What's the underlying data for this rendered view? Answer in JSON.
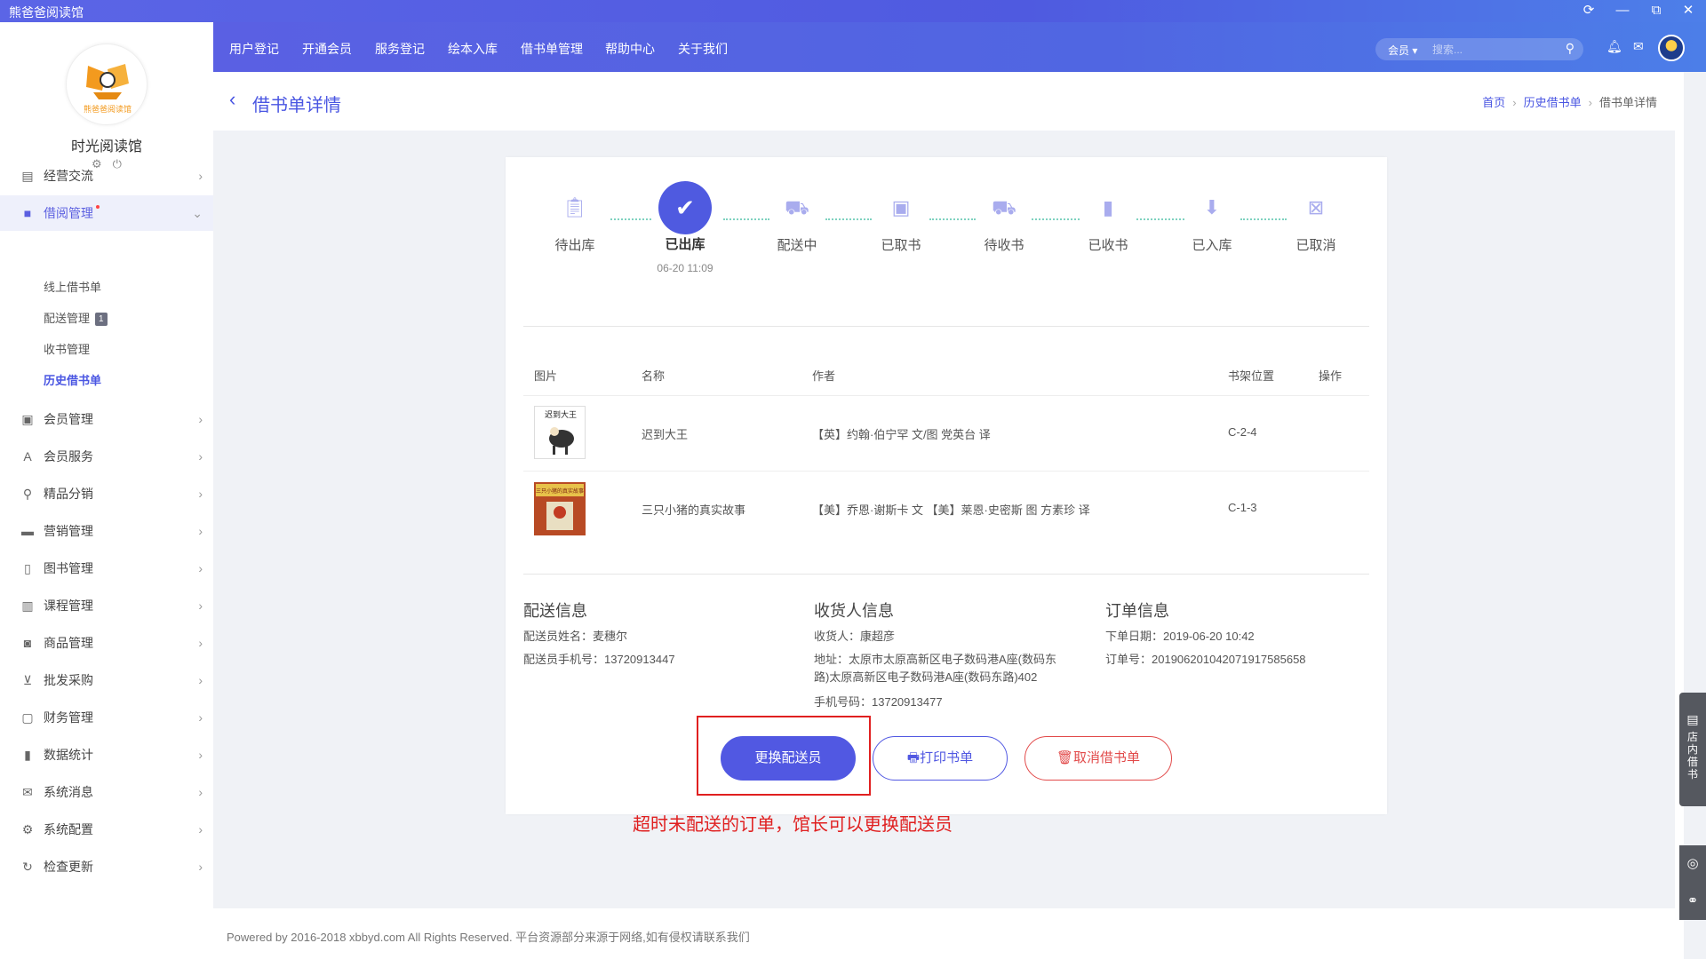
{
  "window": {
    "title": "熊爸爸阅读馆",
    "controls": [
      "refresh-icon",
      "minimize-icon",
      "maximize-icon",
      "close-icon"
    ]
  },
  "sidebar": {
    "logo_text": "熊爸爸阅读馆",
    "store_name": "时光阅读馆",
    "settings_icon": "gear-icon",
    "power_icon": "power-icon",
    "items": [
      {
        "label": "经营交流",
        "icon": "chat-icon"
      },
      {
        "label": "借阅管理",
        "icon": "box-icon",
        "open": true
      },
      {
        "label": "会员管理",
        "icon": "member-card-icon"
      },
      {
        "label": "会员服务",
        "icon": "service-icon"
      },
      {
        "label": "精品分销",
        "icon": "network-icon"
      },
      {
        "label": "营销管理",
        "icon": "ticket-icon"
      },
      {
        "label": "图书管理",
        "icon": "book-icon"
      },
      {
        "label": "课程管理",
        "icon": "course-icon"
      },
      {
        "label": "商品管理",
        "icon": "bag-icon"
      },
      {
        "label": "批发采购",
        "icon": "cart-icon"
      },
      {
        "label": "财务管理",
        "icon": "money-icon"
      },
      {
        "label": "数据统计",
        "icon": "bar-chart-icon"
      },
      {
        "label": "系统消息",
        "icon": "mail-icon"
      },
      {
        "label": "系统配置",
        "icon": "gear-icon"
      },
      {
        "label": "检查更新",
        "icon": "refresh-icon"
      }
    ],
    "subitems": [
      {
        "label": "线上借书单"
      },
      {
        "label": "配送管理",
        "badge": "1"
      },
      {
        "label": "收书管理"
      },
      {
        "label": "历史借书单",
        "active": true
      }
    ]
  },
  "topnav": {
    "links": [
      "用户登记",
      "开通会员",
      "服务登记",
      "绘本入库",
      "借书单管理",
      "帮助中心",
      "关于我们"
    ],
    "search": {
      "scope": "会员",
      "placeholder": "搜索..."
    }
  },
  "header": {
    "title": "借书单详情",
    "breadcrumb": [
      "首页",
      "历史借书单",
      "借书单详情"
    ]
  },
  "steps": [
    {
      "label": "待出库",
      "icon": "clipboard-icon"
    },
    {
      "label": "已出库",
      "icon": "clipboard-check-icon",
      "current": true,
      "time": "06-20 11:09"
    },
    {
      "label": "配送中",
      "icon": "truck-icon"
    },
    {
      "label": "已取书",
      "icon": "picture-book-icon"
    },
    {
      "label": "待收书",
      "icon": "truck-icon"
    },
    {
      "label": "已收书",
      "icon": "bookmark-icon"
    },
    {
      "label": "已入库",
      "icon": "inbox-icon"
    },
    {
      "label": "已取消",
      "icon": "calendar-cancel-icon"
    }
  ],
  "table": {
    "headers": [
      "图片",
      "名称",
      "作者",
      "书架位置",
      "操作"
    ],
    "rows": [
      {
        "cover_title": "迟到大王",
        "name": "迟到大王",
        "author": "【英】约翰·伯宁罕 文/图 党英台 译",
        "shelf": "C-2-4"
      },
      {
        "cover_title": "三只小猪的真实故事",
        "name": "三只小猪的真实故事",
        "author": "【美】乔恩·谢斯卡 文 【美】莱恩·史密斯 图 方素珍 译",
        "shelf": "C-1-3"
      }
    ]
  },
  "delivery": {
    "title": "配送信息",
    "name_label": "配送员姓名：",
    "name": "麦穗尔",
    "phone_label": "配送员手机号：",
    "phone": "13720913447"
  },
  "receiver": {
    "title": "收货人信息",
    "name_label": "收货人：",
    "name": "康超彦",
    "address_label": "地址：",
    "address_line1": "太原市太原高新区电子数码港A座(数码东",
    "address_line2": "路)太原高新区电子数码港A座(数码东路)402",
    "phone_label": "手机号码：",
    "phone": "13720913477"
  },
  "order": {
    "title": "订单信息",
    "date_label": "下单日期：",
    "date": "2019-06-20 10:42",
    "number_label": "订单号：",
    "number": "20190620104207191758565​8"
  },
  "actions": {
    "change_courier": "更换配送员",
    "print": "打印书单",
    "cancel": "取消借书单"
  },
  "annotation": "超时未配送的订单，馆长可以更换配送员",
  "float_bar": {
    "label": "店内借书"
  },
  "footer": {
    "text": "Powered by 2016-2018 xbbyd.com All Rights Reserved. 平台资源部分来源于网络,如有侵权请联系我们"
  }
}
